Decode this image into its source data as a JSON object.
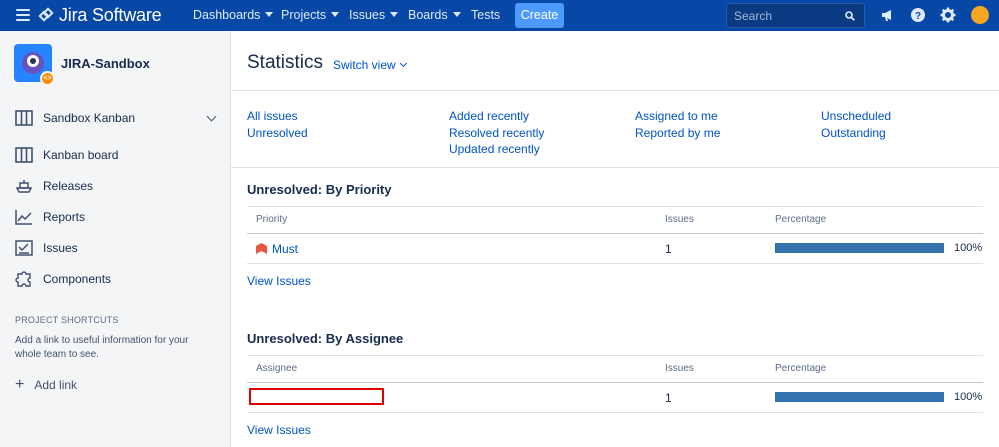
{
  "nav": {
    "brand": "Jira Software",
    "items": [
      {
        "label": "Dashboards",
        "dropdown": true
      },
      {
        "label": "Projects",
        "dropdown": true
      },
      {
        "label": "Issues",
        "dropdown": true
      },
      {
        "label": "Boards",
        "dropdown": true
      },
      {
        "label": "Tests",
        "dropdown": false
      }
    ],
    "create_label": "Create",
    "search_placeholder": "Search",
    "icons": [
      "menu-icon",
      "search-icon",
      "megaphone-icon",
      "help-icon",
      "gear-icon",
      "avatar"
    ]
  },
  "sidebar": {
    "project_name": "JIRA-Sandbox",
    "board_selector": "Sandbox Kanban",
    "items": [
      {
        "label": "Kanban board",
        "icon": "board-icon"
      },
      {
        "label": "Releases",
        "icon": "ship-icon"
      },
      {
        "label": "Reports",
        "icon": "chart-icon"
      },
      {
        "label": "Issues",
        "icon": "issues-icon"
      },
      {
        "label": "Components",
        "icon": "puzzle-icon"
      }
    ],
    "shortcuts_heading": "PROJECT SHORTCUTS",
    "shortcuts_text": "Add a link to useful information for your whole team to see.",
    "add_link": "Add link"
  },
  "main": {
    "title": "Statistics",
    "switch_view": "Switch view",
    "filters": [
      [
        "All issues",
        "Unresolved"
      ],
      [
        "Added recently",
        "Resolved recently",
        "Updated recently"
      ],
      [
        "Assigned to me",
        "Reported by me"
      ],
      [
        "Unscheduled",
        "Outstanding"
      ]
    ],
    "by_priority": {
      "heading": "Unresolved: By Priority",
      "col_name": "Priority",
      "col_issues": "Issues",
      "col_pct": "Percentage",
      "rows": [
        {
          "name": "Must",
          "issues": "1",
          "percent_value": 100,
          "percent": "100%"
        }
      ],
      "view_link": "View Issues"
    },
    "by_assignee": {
      "heading": "Unresolved: By Assignee",
      "col_name": "Assignee",
      "col_issues": "Issues",
      "col_pct": "Percentage",
      "rows": [
        {
          "name": "",
          "issues": "1",
          "percent_value": 100,
          "percent": "100%"
        }
      ],
      "view_link": "View Issues"
    }
  },
  "colors": {
    "nav_bg": "#0747a6",
    "link": "#0052cc",
    "bar": "#3572b0",
    "create": "#4c9aff",
    "highlight": "#e00000"
  }
}
